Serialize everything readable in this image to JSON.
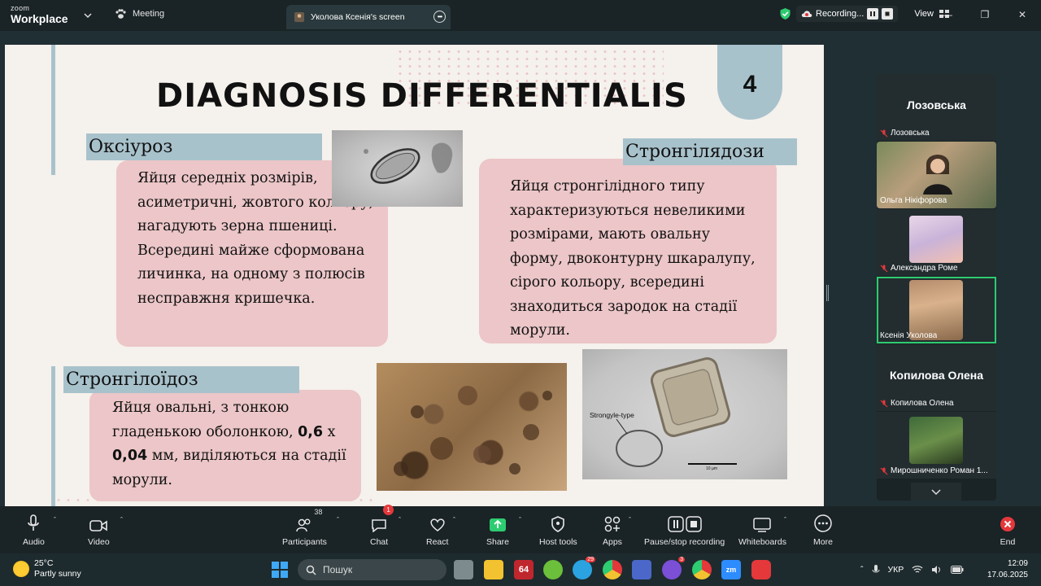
{
  "topbar": {
    "brand_zoom": "zoom",
    "brand_workplace": "Workplace",
    "meeting_label": "Meeting",
    "share_tab_label": "Уколова Ксенія's screen",
    "recording_label": "Recording...",
    "view_label": "View"
  },
  "slide": {
    "title": "DIAGNOSIS DIFFERENTIALIS",
    "number": "4",
    "section1_header": "Оксіуроз",
    "section1_text": "Яйця середніх розмірів, асиметричні, жовтого кольору, нагадують зерна пшениці. Всередині майже сформована личинка, на одному з полюсів несправжня кришечка.",
    "section2_header": "Стронгілядози",
    "section2_text": "Яйця стронгілідного типу характеризуються невеликими розмірами, мають овальну форму, двоконтурну шкаралупу, сірого кольору, всередині знаходиться зародок на стадії морули.",
    "section3_header": "Стронгілоїдоз",
    "section3_text_a": "Яйця овальні, з тонкою гладенькою оболонкою, ",
    "section3_bold1": "0,6",
    "section3_text_b": " х ",
    "section3_bold2": "0,04",
    "section3_text_c": " мм, виділяються на стадії морули.",
    "photo3_label": "Strongyle-type",
    "photo3_scale": "10 µm"
  },
  "gallery": {
    "tiles": [
      {
        "big_name": "Лозовська",
        "label": "Лозовська"
      },
      {
        "label": "Ольга Нікіфорова"
      },
      {
        "label": "Александра Роме"
      },
      {
        "label": "Ксенія Уколова"
      },
      {
        "big_name": "Копилова Олена",
        "label": "Копилова Олена"
      },
      {
        "label": "Мирошниченко Роман 1..."
      }
    ]
  },
  "toolbar": {
    "audio": "Audio",
    "video": "Video",
    "participants": "Participants",
    "participants_count": "38",
    "chat": "Chat",
    "chat_badge": "1",
    "react": "React",
    "share": "Share",
    "host_tools": "Host tools",
    "apps": "Apps",
    "pause_stop": "Pause/stop recording",
    "whiteboards": "Whiteboards",
    "more": "More",
    "end": "End"
  },
  "taskbar": {
    "temp": "25°C",
    "weather": "Partly sunny",
    "search_placeholder": "Пошук",
    "app_64": "64",
    "badge_telegram": "29",
    "badge_viber": "3",
    "lang": "УКР",
    "time": "12:09",
    "date": "17.06.2025"
  },
  "colors": {
    "accent_blue": "#a8c2cc",
    "pink_box": "#ecc6c8",
    "active_green": "#2ecc71",
    "badge_red": "#e5383b"
  }
}
